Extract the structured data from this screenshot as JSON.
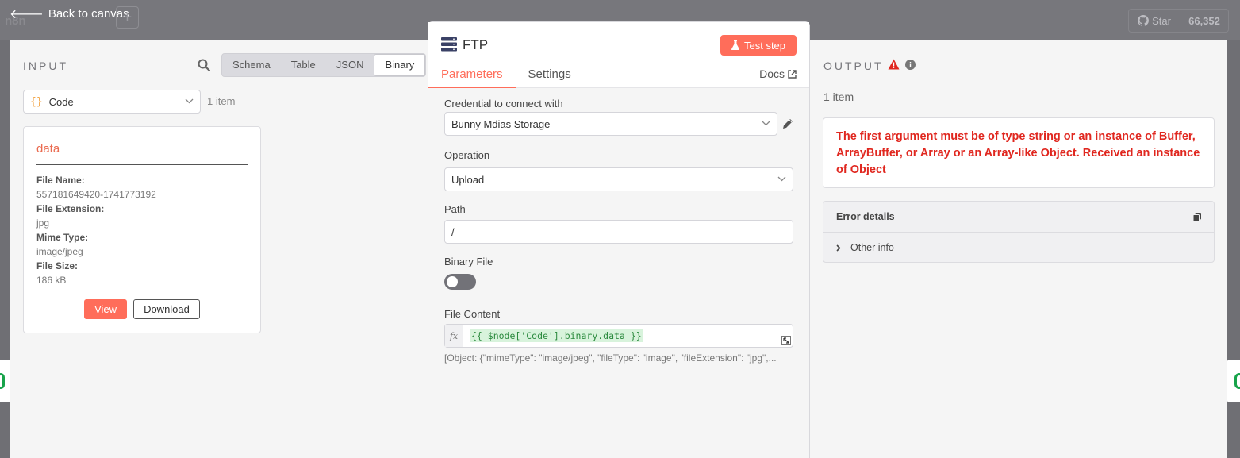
{
  "background": {
    "back_label": "Back to canvas",
    "logo_text": "n8n",
    "plus_label": "+",
    "github": {
      "star_label": "Star",
      "star_count": "66,352"
    }
  },
  "input": {
    "title": "INPUT",
    "view_tabs": [
      "Schema",
      "Table",
      "JSON",
      "Binary"
    ],
    "active_tab": "Binary",
    "node_select": {
      "icon": "{}",
      "value": "Code"
    },
    "item_count": "1 item",
    "binary_card": {
      "title": "data",
      "fields": [
        {
          "key": "File Name:",
          "value": "557181649420-1741773192"
        },
        {
          "key": "File Extension:",
          "value": "jpg"
        },
        {
          "key": "Mime Type:",
          "value": "image/jpeg"
        },
        {
          "key": "File Size:",
          "value": "186 kB"
        }
      ],
      "view_label": "View",
      "download_label": "Download"
    }
  },
  "node": {
    "title": "FTP",
    "test_label": "Test step",
    "tabs": [
      "Parameters",
      "Settings"
    ],
    "active_tab": "Parameters",
    "docs_label": "Docs",
    "credential": {
      "label": "Credential to connect with",
      "value": "Bunny Mdias Storage"
    },
    "operation": {
      "label": "Operation",
      "value": "Upload"
    },
    "path": {
      "label": "Path",
      "value": "/"
    },
    "binary_file": {
      "label": "Binary File",
      "enabled": false
    },
    "file_content": {
      "label": "File Content",
      "fx_label": "fx",
      "expression": "{{ $node['Code'].binary.data }}",
      "preview": "[Object: {\"mimeType\": \"image/jpeg\", \"fileType\": \"image\", \"fileExtension\": \"jpg\",..."
    }
  },
  "output": {
    "title": "OUTPUT",
    "item_count": "1 item",
    "error_message": "The first argument must be of type string or an instance of Buffer, ArrayBuffer, or Array or an Array-like Object. Received an instance of Object",
    "error_details_label": "Error details",
    "other_info_label": "Other info"
  },
  "colors": {
    "accent": "#ff6d5a",
    "error": "#e0271f",
    "expression_green": "#2b8a3e",
    "code_orange": "#f2a03c"
  }
}
